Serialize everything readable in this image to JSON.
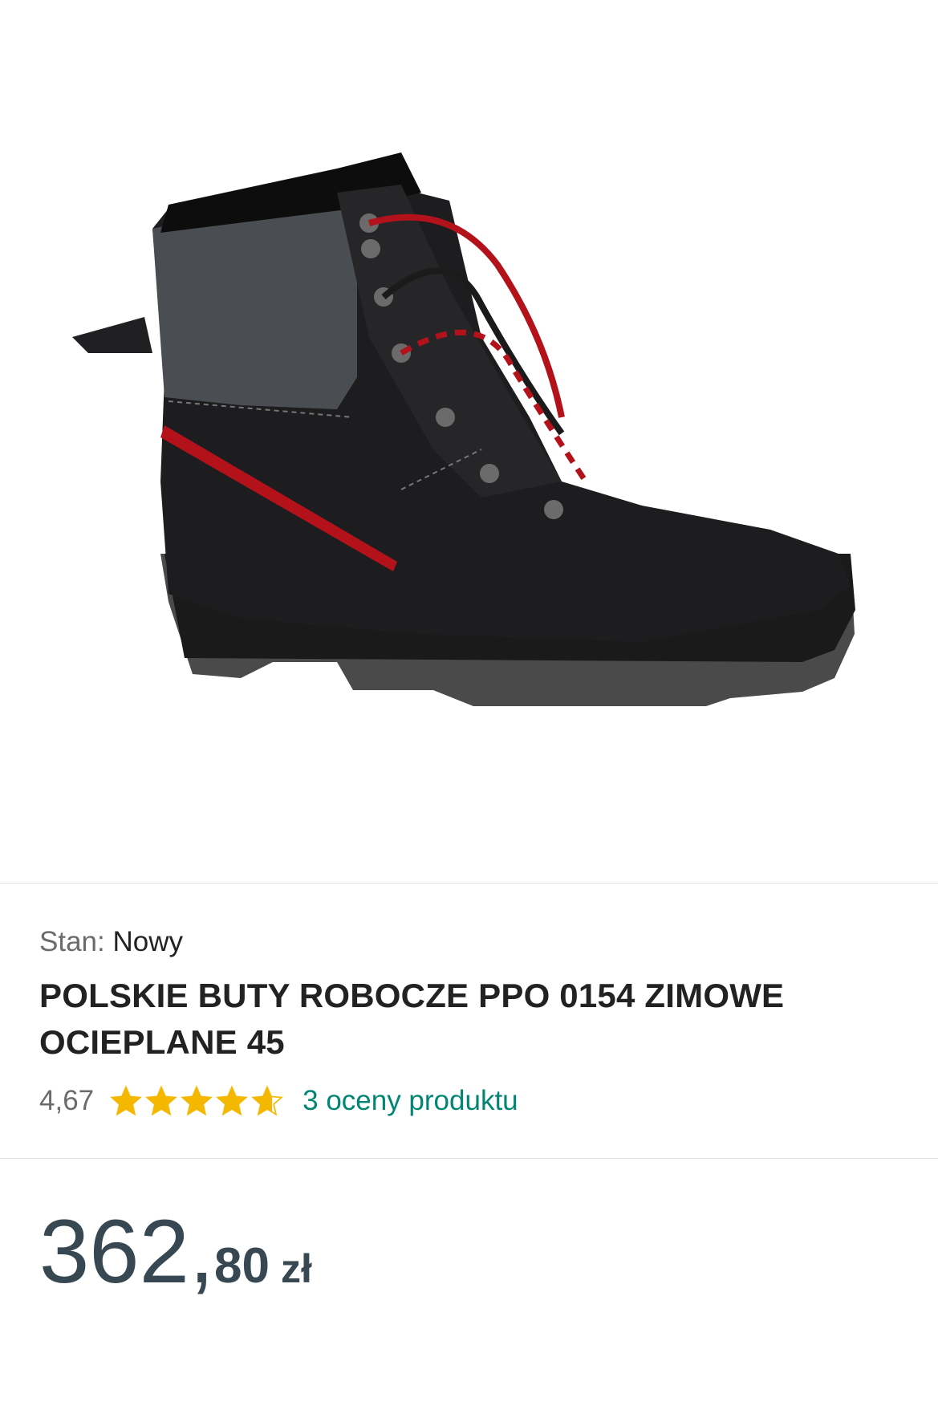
{
  "product": {
    "image_alt": "product-image-work-boot",
    "condition_label": "Stan:",
    "condition_value": "Nowy",
    "title": "POLSKIE BUTY ROBOCZE PPO 0154 ZIMOWE OCIEPLANE 45",
    "rating_value": "4,67",
    "rating_stars": 4.67,
    "rating_max": 5,
    "reviews_link": "3 oceny produktu",
    "price_integer": "362,",
    "price_fraction": "80",
    "price_currency": "zł"
  },
  "colors": {
    "star": "#f5b800",
    "link": "#008673",
    "price": "#384852",
    "divider": "#e4e4e4"
  },
  "icons": {
    "star": "star-icon"
  }
}
